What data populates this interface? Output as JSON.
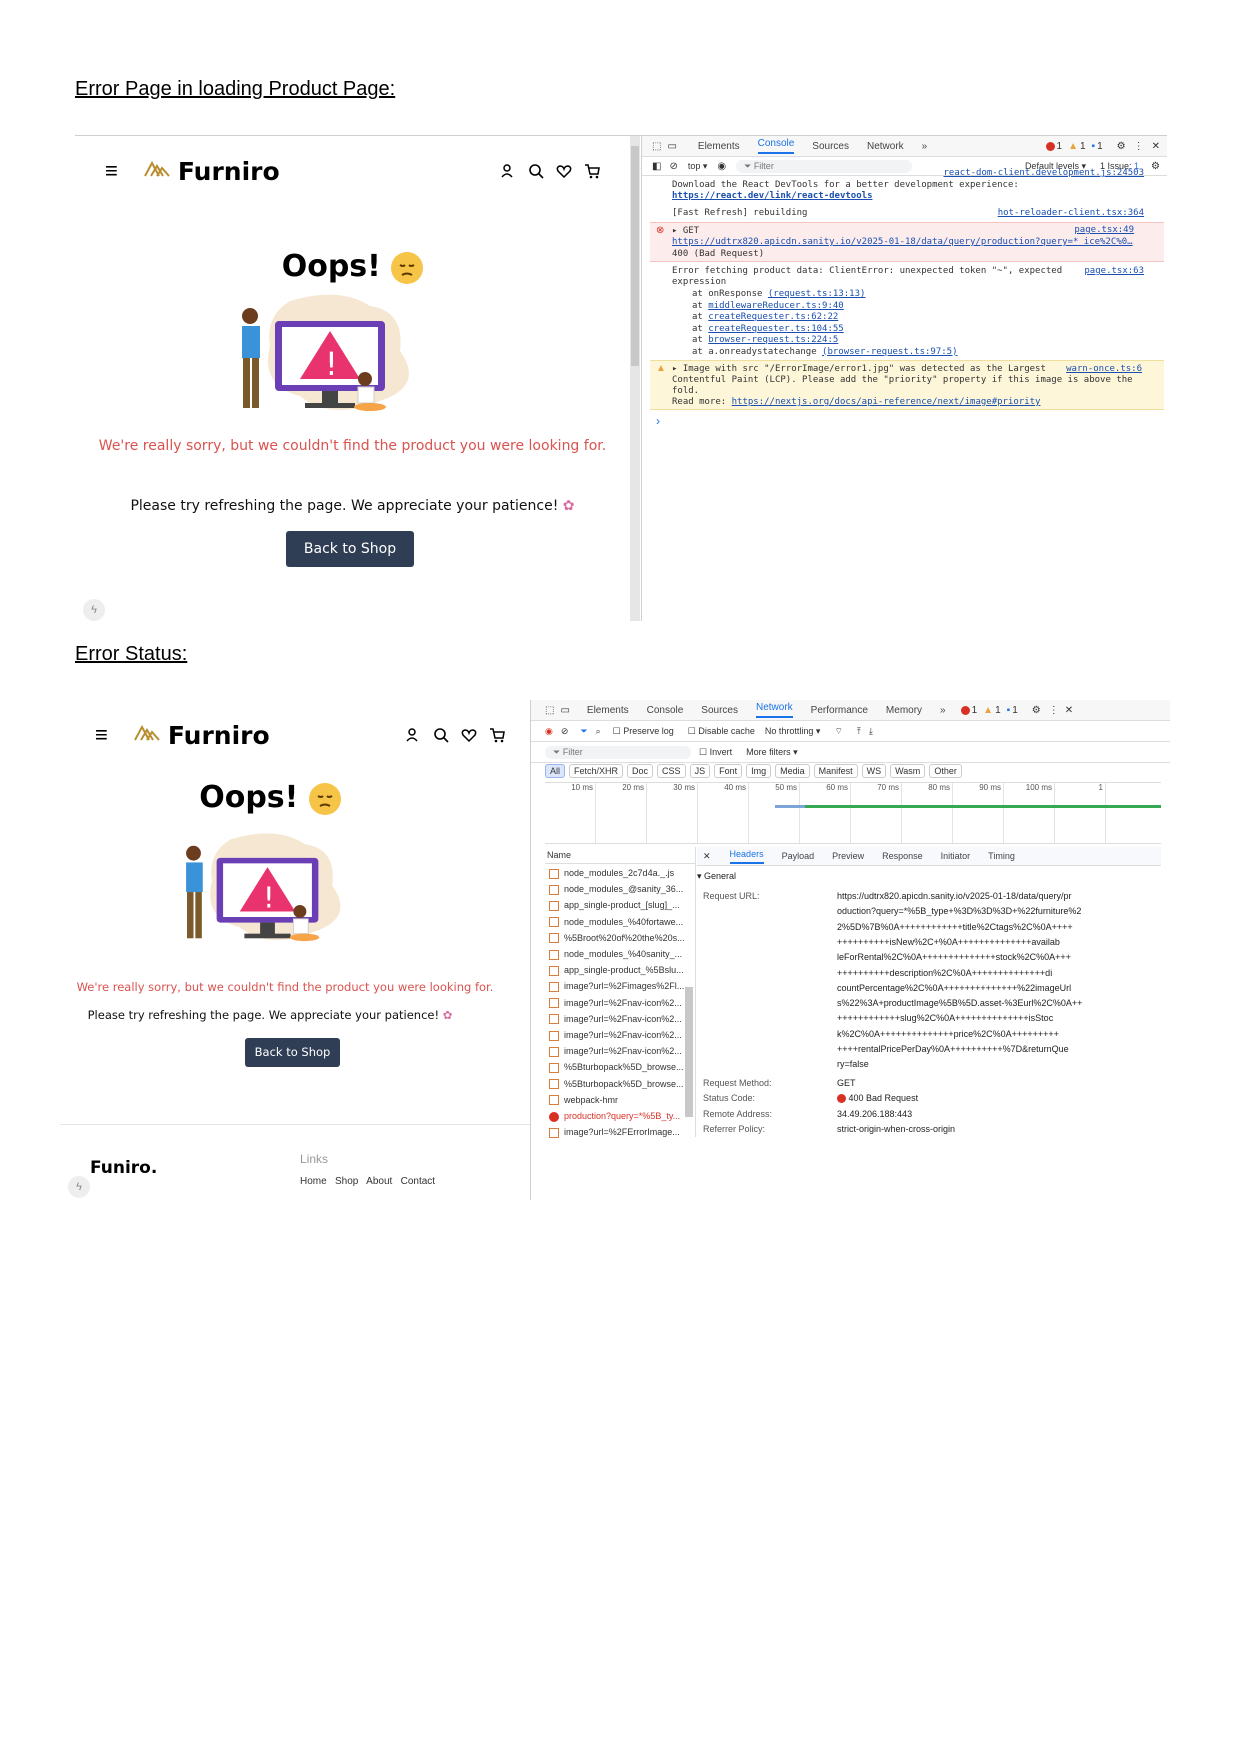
{
  "headings": {
    "first": "Error Page in loading Product Page:",
    "second": "Error Status:"
  },
  "site": {
    "brand": "Furniro",
    "oops": "Oops!",
    "sorry": "We're really sorry, but we couldn't find the product you were looking for.",
    "refresh": "Please try refreshing the page. We appreciate your patience!",
    "back_button": "Back to Shop",
    "footer_brand": "Funiro.",
    "footer_links": "Links",
    "footer_sub": "Home   Shop   About   Contact"
  },
  "console_panel": {
    "tabs": [
      "Elements",
      "Console",
      "Sources",
      "Network",
      "»"
    ],
    "active_tab": "Console",
    "counts": {
      "errors": "1",
      "warnings": "1",
      "info": "1"
    },
    "context": "top ▾",
    "filter_placeholder": "Filter",
    "levels": "Default levels ▾",
    "issues": "1 Issue: ",
    "issues_count": "1",
    "lines": {
      "react_src": "react-dom-client.development.js:24503",
      "devtools_msg": "Download the React DevTools for a better development experience:",
      "devtools_link": "https://react.dev/link/react-devtools",
      "fast_refresh": "[Fast Refresh] rebuilding",
      "fast_refresh_src": "hot-reloader-client.tsx:364",
      "get": "▸ GET",
      "get_src": "page.tsx:49",
      "get_url": "https://udtrx820.apicdn.sanity.io/v2025-01-18/data/query/production?query=*_ice%2C%0…",
      "bad_request": "400 (Bad Request)",
      "fetch_error": "Error fetching product data: ClientError: unexpected token \"~\", expected",
      "fetch_error_src": "page.tsx:63",
      "expression": "expression",
      "stack": [
        {
          "at": "at onResponse",
          "src": "(request.ts:13:13)"
        },
        {
          "at": "at",
          "src": "middlewareReducer.ts:9:40"
        },
        {
          "at": "at",
          "src": "createRequester.ts:62:22"
        },
        {
          "at": "at",
          "src": "createRequester.ts:104:55"
        },
        {
          "at": "at",
          "src": "browser-request.ts:224:5"
        },
        {
          "at": "at a.onreadystatechange",
          "src": "(browser-request.ts:97:5)"
        }
      ],
      "warn_1": "▸ Image with src \"/ErrorImage/error1.jpg\" was detected as the Largest",
      "warn_src": "warn-once.ts:6",
      "warn_2": "Contentful Paint (LCP). Please add the \"priority\" property if this image is above the",
      "warn_3": "fold.",
      "warn_4": "Read more:",
      "warn_link": "https://nextjs.org/docs/api-reference/next/image#priority",
      "prompt": "›"
    }
  },
  "network_panel": {
    "tabs": [
      "Elements",
      "Console",
      "Sources",
      "Network",
      "Performance",
      "Memory",
      "»"
    ],
    "active_tab": "Network",
    "counts": {
      "errors": "1",
      "warnings": "1",
      "info": "1"
    },
    "preserve_log": "Preserve log",
    "disable_cache": "Disable cache",
    "throttling": "No throttling",
    "filter_placeholder": "Filter",
    "invert": "Invert",
    "more_filters": "More filters ▾",
    "type_filters": [
      "All",
      "Fetch/XHR",
      "Doc",
      "CSS",
      "JS",
      "Font",
      "Img",
      "Media",
      "Manifest",
      "WS",
      "Wasm",
      "Other"
    ],
    "timeline_ticks": [
      "10 ms",
      "20 ms",
      "30 ms",
      "40 ms",
      "50 ms",
      "60 ms",
      "70 ms",
      "80 ms",
      "90 ms",
      "100 ms",
      "1"
    ],
    "name_header": "Name",
    "requests": [
      "node_modules_2c7d4a._.js",
      "node_modules_@sanity_36...",
      "app_single-product_[slug]_...",
      "node_modules_%40fortawe...",
      "%5Broot%20of%20the%20s...",
      "node_modules_%40sanity_...",
      "app_single-product_%5Bslu...",
      "image?url=%2Fimages%2Fl...",
      "image?url=%2Fnav-icon%2...",
      "image?url=%2Fnav-icon%2...",
      "image?url=%2Fnav-icon%2...",
      "image?url=%2Fnav-icon%2...",
      "%5Bturbopack%5D_browse...",
      "%5Bturbopack%5D_browse...",
      "webpack-hmr",
      "production?query=*%5B_ty...",
      "image?url=%2FErrorImage..."
    ],
    "detail_tabs": [
      "Headers",
      "Payload",
      "Preview",
      "Response",
      "Initiator",
      "Timing"
    ],
    "detail_close": "✕",
    "general_label": "▾ General",
    "request_url_label": "Request URL:",
    "request_url_lines": [
      "https://udtrx820.apicdn.sanity.io/v2025-01-18/data/query/pr",
      "oduction?query=*%5B_type+%3D%3D%3D+%22furniture%2",
      "2%5D%7B%0A++++++++++++title%2Ctags%2C%0A++++",
      "++++++++++isNew%2C+%0A++++++++++++++availab",
      "leForRental%2C%0A++++++++++++++stock%2C%0A+++",
      "++++++++++description%2C%0A++++++++++++++di",
      "countPercentage%2C%0A++++++++++++++%22imageUrl",
      "s%22%3A+productImage%5B%5D.asset-%3Eurl%2C%0A++",
      "++++++++++++slug%2C%0A++++++++++++++isStoc",
      "k%2C%0A++++++++++++++price%2C%0A+++++++++",
      "++++rentalPricePerDay%0A++++++++++%7D&returnQue",
      "ry=false"
    ],
    "request_method_label": "Request Method:",
    "request_method": "GET",
    "status_code_label": "Status Code:",
    "status_code": "400 Bad Request",
    "remote_address_label": "Remote Address:",
    "remote_address": "34.49.206.188:443",
    "referrer_policy_label": "Referrer Policy:",
    "referrer_policy": "strict-origin-when-cross-origin"
  },
  "colors": {
    "accent": "#1a73e8",
    "error": "#d93025",
    "warning": "#e8a33d",
    "brand_gold": "#b88e2f",
    "button": "#2f3e55",
    "sorry_text": "#d9534f"
  }
}
